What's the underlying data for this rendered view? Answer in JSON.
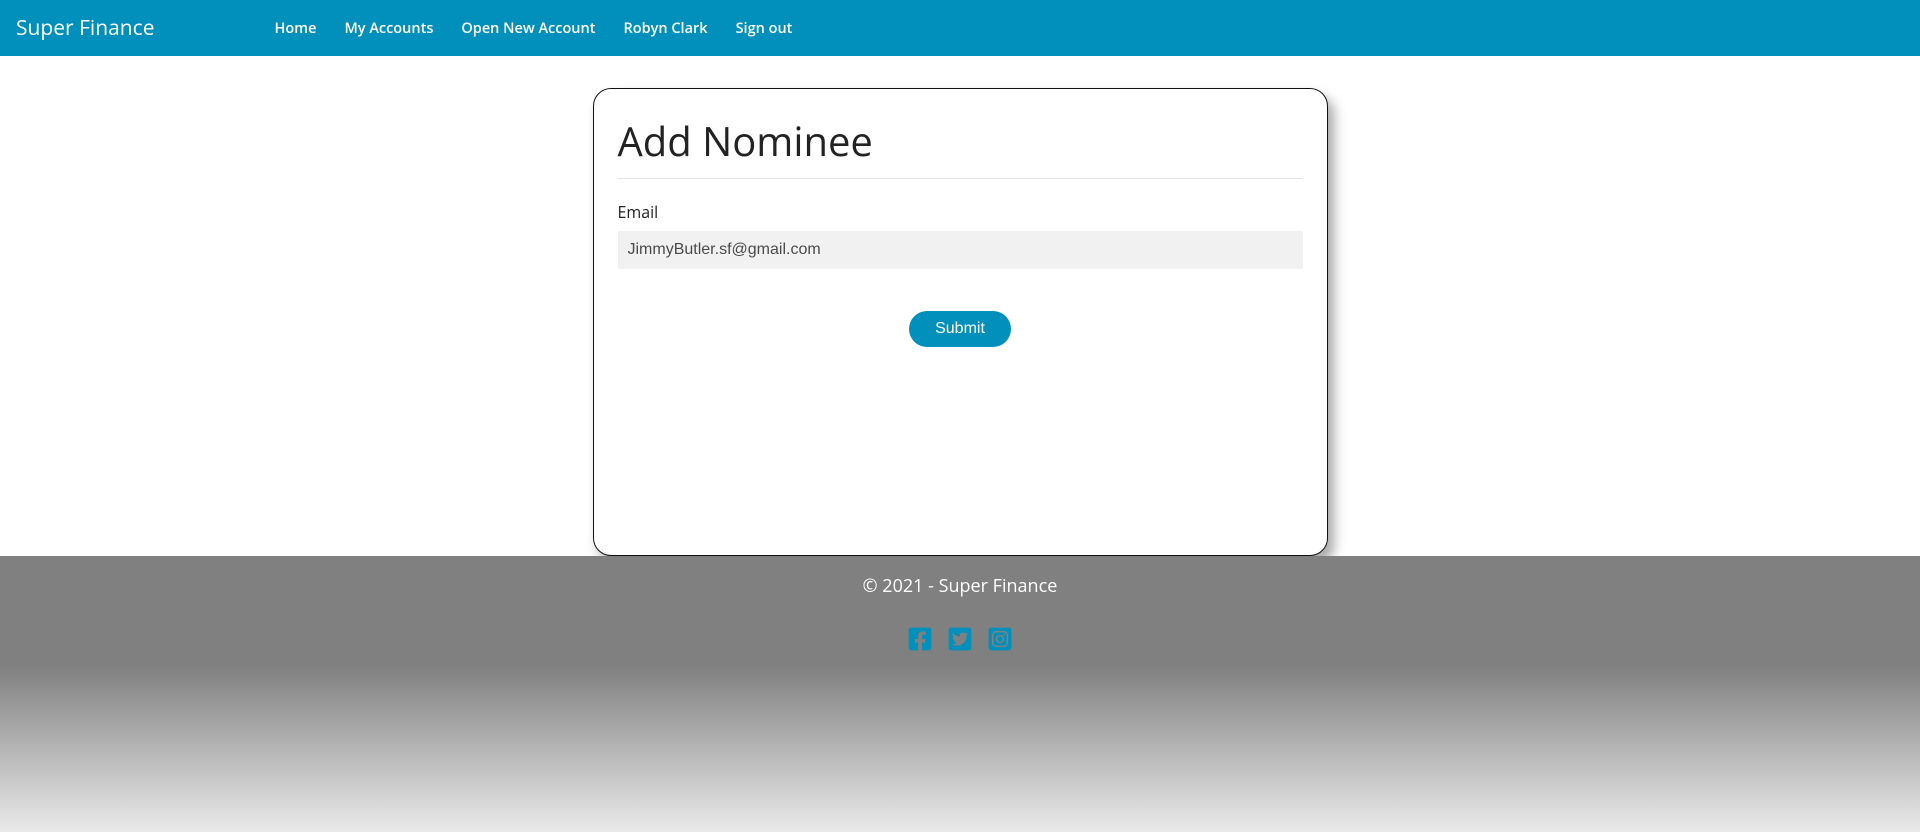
{
  "brand": "Super Finance",
  "nav": {
    "home": "Home",
    "my_accounts": "My Accounts",
    "open_new": "Open New Account",
    "user": "Robyn Clark",
    "sign_out": "Sign out"
  },
  "form": {
    "title": "Add Nominee",
    "email_label": "Email",
    "email_value": "JimmyButler.sf@gmail.com",
    "submit": "Submit"
  },
  "footer": {
    "copyright": "© 2021 - Super Finance"
  },
  "icons": {
    "facebook": "facebook-icon",
    "twitter": "twitter-icon",
    "instagram": "instagram-icon"
  }
}
